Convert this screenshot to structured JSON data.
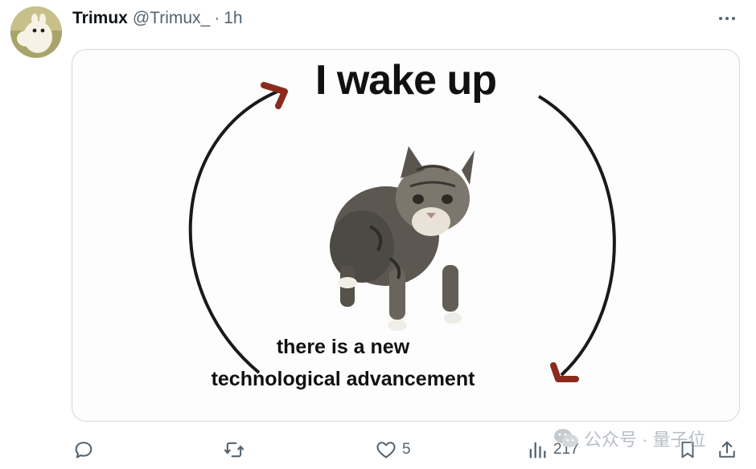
{
  "tweet": {
    "display_name": "Trimux",
    "handle": "@Trimux_",
    "separator": "·",
    "time": "1h",
    "more_icon": "more-dots-icon",
    "avatar_icon": "moomin-avatar"
  },
  "meme": {
    "title": "I wake up",
    "caption_line1": "there is a new",
    "caption_line2": "technological advancement",
    "arrow_color": "#8b2a1e"
  },
  "actions": {
    "reply": {
      "icon": "reply-icon",
      "count": ""
    },
    "retweet": {
      "icon": "retweet-icon",
      "count": ""
    },
    "like": {
      "icon": "heart-icon",
      "count": "5"
    },
    "views": {
      "icon": "views-chart-icon",
      "count": "217"
    },
    "bookmark": {
      "icon": "bookmark-icon",
      "count": ""
    },
    "share": {
      "icon": "share-icon",
      "count": ""
    }
  },
  "watermark": {
    "text": "公众号 · 量子位",
    "icon": "wechat-icon"
  }
}
